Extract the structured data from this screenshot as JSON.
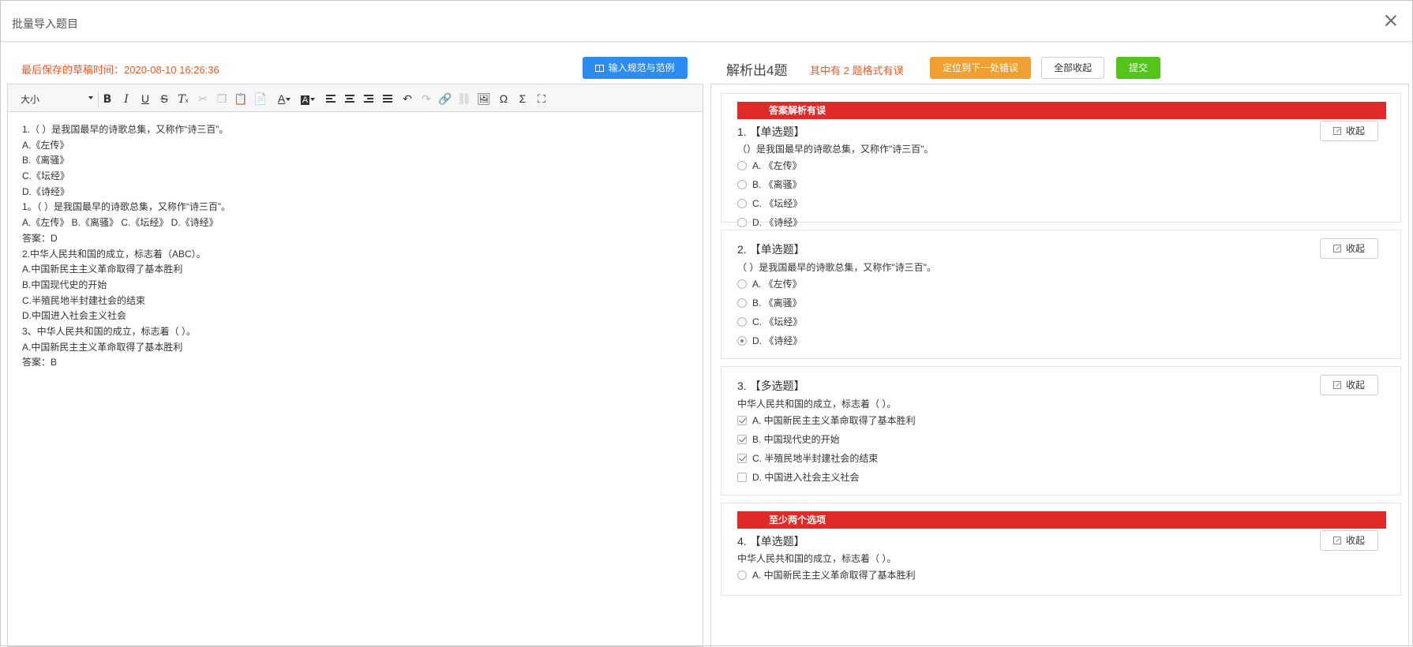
{
  "dialog": {
    "title": "批量导入题目"
  },
  "left": {
    "draft_time": "最后保存的草稿时间：2020-08-10 16:26:36",
    "rule_button": "输入规范与范例",
    "toolbar": {
      "font_size": "大小",
      "font_color_letter": "A",
      "bg_color_letter": "A",
      "omega": "Ω",
      "sigma": "Σ"
    },
    "content_lines": [
      "1.（ ）是我国最早的诗歌总集，又称作“诗三百”。",
      "A.《左传》",
      "B.《离骚》",
      "C.《坛经》",
      "D.《诗经》",
      "1。（ ）是我国最早的诗歌总集，又称作“诗三百”。",
      "A.《左传》 B.《离骚》 C.《坛经》 D.《诗经》",
      "答案：D",
      "2.中华人民共和国的成立，标志着（ABC）。",
      "A.中国新民主主义革命取得了基本胜利",
      "B.中国现代史的开始",
      "C.半殖民地半封建社会的结束",
      "D.中国进入社会主义社会",
      "3、中华人民共和国的成立，标志着（ ）。",
      "A.中国新民主主义革命取得了基本胜利",
      "答案：B"
    ]
  },
  "right": {
    "parse_title": "解析出4题",
    "error_summary": "其中有 2 题格式有误",
    "locate_button": "定位到下一处错误",
    "collapse_all_button": "全部收起",
    "submit_button": "提交",
    "collapse_label": "收起",
    "questions": [
      {
        "error": "答案解析有误",
        "title": "1. 【单选题】",
        "stem": "（）是我国最早的诗歌总集，又称作\"诗三百\"。",
        "options": [
          "A. 《左传》",
          "B. 《离骚》",
          "C. 《坛经》",
          "D. 《诗经》"
        ]
      },
      {
        "title": "2. 【单选题】",
        "stem": "（ ）是我国最早的诗歌总集，又称作\"诗三百\"。",
        "options": [
          "A. 《左传》",
          "B. 《离骚》",
          "C. 《坛经》",
          "D. 《诗经》"
        ]
      },
      {
        "title": "3. 【多选题】",
        "stem": "中华人民共和国的成立，标志着（ ）。",
        "options": [
          "A. 中国新民主主义革命取得了基本胜利",
          "B. 中国现代史的开始",
          "C. 半殖民地半封建社会的结束",
          "D. 中国进入社会主义社会"
        ]
      },
      {
        "error": "至少两个选项",
        "title": "4. 【单选题】",
        "stem": "中华人民共和国的成立，标志着（ ）。",
        "options": [
          "A. 中国新民主主义革命取得了基本胜利"
        ]
      }
    ]
  }
}
